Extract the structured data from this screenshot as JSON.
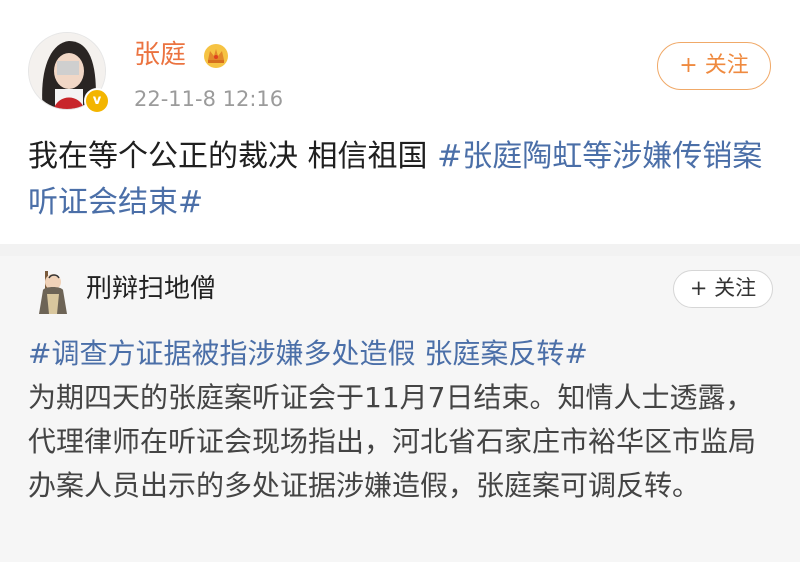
{
  "post1": {
    "author": "张庭",
    "timestamp": "22-11-8 12:16",
    "follow_label": "+ 关注",
    "text_plain": "我在等个公正的裁决 相信祖国 ",
    "hashtag": "#张庭陶虹等涉嫌传销案听证会结束#",
    "verified_icon": "v-badge-icon",
    "member_icon": "crown-icon",
    "colors": {
      "name": "#eb7340",
      "hashtag": "#4b6fa8",
      "follow": "#ef8a3f"
    }
  },
  "post2": {
    "author": "刑辩扫地僧",
    "follow_label": "+ 关注",
    "hashtag": "#调查方证据被指涉嫌多处造假 张庭案反转#",
    "body": "为期四天的张庭案听证会于11月7日结束。知情人士透露，代理律师在听证会现场指出，河北省石家庄市裕华区市监局办案人员出示的多处证据涉嫌造假，张庭案可调反转。"
  }
}
